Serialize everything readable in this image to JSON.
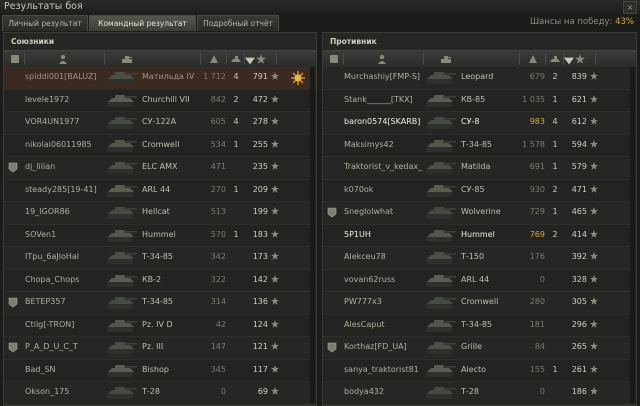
{
  "window": {
    "title": "Результаты боя",
    "close": "×"
  },
  "tabs": [
    {
      "label": "Личный результат"
    },
    {
      "label": "Командный результат"
    },
    {
      "label": "Подробный отчёт"
    }
  ],
  "chance": {
    "label": "Шансы на победу:",
    "value": "43%"
  },
  "allies": {
    "title": "Союзники",
    "rows": [
      {
        "name": "spiddi001[BALUZ]",
        "tank": "Матильда IV",
        "dmg": "1 712",
        "kills": "4",
        "xp": "791",
        "player": true,
        "medal": true
      },
      {
        "name": "levele1972",
        "tank": "Churchill VII",
        "dmg": "842",
        "kills": "2",
        "xp": "472"
      },
      {
        "name": "VOR4UN1977",
        "tank": "СУ-122А",
        "dmg": "605",
        "kills": "4",
        "xp": "278"
      },
      {
        "name": "nikolai06011985",
        "tank": "Cromwell",
        "dmg": "534",
        "kills": "1",
        "xp": "255"
      },
      {
        "name": "dj_lilian",
        "tank": "ELC AMX",
        "dmg": "471",
        "kills": "",
        "xp": "235",
        "platoon": true
      },
      {
        "name": "steady285[19-41]",
        "tank": "ARL 44",
        "dmg": "270",
        "kills": "1",
        "xp": "209"
      },
      {
        "name": "19_IGOR86",
        "tank": "Hellcat",
        "dmg": "513",
        "kills": "",
        "xp": "199"
      },
      {
        "name": "SOVen1",
        "tank": "Hummel",
        "dmg": "570",
        "kills": "1",
        "xp": "183"
      },
      {
        "name": "ITpu_6aJloHal",
        "tank": "Т-34-85",
        "dmg": "342",
        "kills": "",
        "xp": "173"
      },
      {
        "name": "Chopa_Chops",
        "tank": "КВ-2",
        "dmg": "322",
        "kills": "",
        "xp": "142"
      },
      {
        "name": "BETEP357",
        "tank": "Т-34-85",
        "dmg": "314",
        "kills": "",
        "xp": "136",
        "platoon": true
      },
      {
        "name": "Ctilg[-TRON]",
        "tank": "Pz. IV D",
        "dmg": "42",
        "kills": "",
        "xp": "124"
      },
      {
        "name": "P_A_D_U_C_T",
        "tank": "Pz. III",
        "dmg": "147",
        "kills": "",
        "xp": "121",
        "platoon": true
      },
      {
        "name": "Bad_SN",
        "tank": "Bishop",
        "dmg": "345",
        "kills": "",
        "xp": "117"
      },
      {
        "name": "Okson_175",
        "tank": "Т-28",
        "dmg": "0",
        "kills": "",
        "xp": "69"
      }
    ]
  },
  "enemies": {
    "title": "Противник",
    "rows": [
      {
        "name": "Murchashiy[FMP-S]",
        "tank": "Leopard",
        "dmg": "679",
        "kills": "2",
        "xp": "839"
      },
      {
        "name": "Stank______[TKX]",
        "tank": "КВ-85",
        "dmg": "1 035",
        "kills": "1",
        "xp": "621"
      },
      {
        "name": "baron0574[SKARB]",
        "tank": "СУ-8",
        "dmg": "983",
        "kills": "4",
        "xp": "612",
        "highlight": true
      },
      {
        "name": "Maksimys42",
        "tank": "Т-34-85",
        "dmg": "1 578",
        "kills": "1",
        "xp": "594"
      },
      {
        "name": "Traktorist_v_kedax_",
        "tank": "Matilda",
        "dmg": "691",
        "kills": "1",
        "xp": "579"
      },
      {
        "name": "k070ok",
        "tank": "СУ-85",
        "dmg": "930",
        "kills": "2",
        "xp": "471"
      },
      {
        "name": "Sneglolwhat",
        "tank": "Wolverine",
        "dmg": "729",
        "kills": "1",
        "xp": "465",
        "platoon": true
      },
      {
        "name": "5P1UH",
        "tank": "Hummel",
        "dmg": "769",
        "kills": "2",
        "xp": "414",
        "highlight": true
      },
      {
        "name": "Alekceu78",
        "tank": "Т-150",
        "dmg": "176",
        "kills": "",
        "xp": "392"
      },
      {
        "name": "vovan62russ",
        "tank": "ARL 44",
        "dmg": "0",
        "kills": "",
        "xp": "328"
      },
      {
        "name": "PW777x3",
        "tank": "Cromwell",
        "dmg": "280",
        "kills": "",
        "xp": "305"
      },
      {
        "name": "AlesCaput",
        "tank": "Т-34-85",
        "dmg": "181",
        "kills": "",
        "xp": "296"
      },
      {
        "name": "Korthaz[FD_UA]",
        "tank": "Grille",
        "dmg": "84",
        "kills": "",
        "xp": "265",
        "platoon": true
      },
      {
        "name": "sanya_traktorist81",
        "tank": "Alecto",
        "dmg": "155",
        "kills": "1",
        "xp": "261"
      },
      {
        "name": "bodya432",
        "tank": "Т-28",
        "dmg": "0",
        "kills": "",
        "xp": "186"
      }
    ]
  },
  "colors": {
    "accent": "#d9a640",
    "player_row": "#3b2a22"
  }
}
